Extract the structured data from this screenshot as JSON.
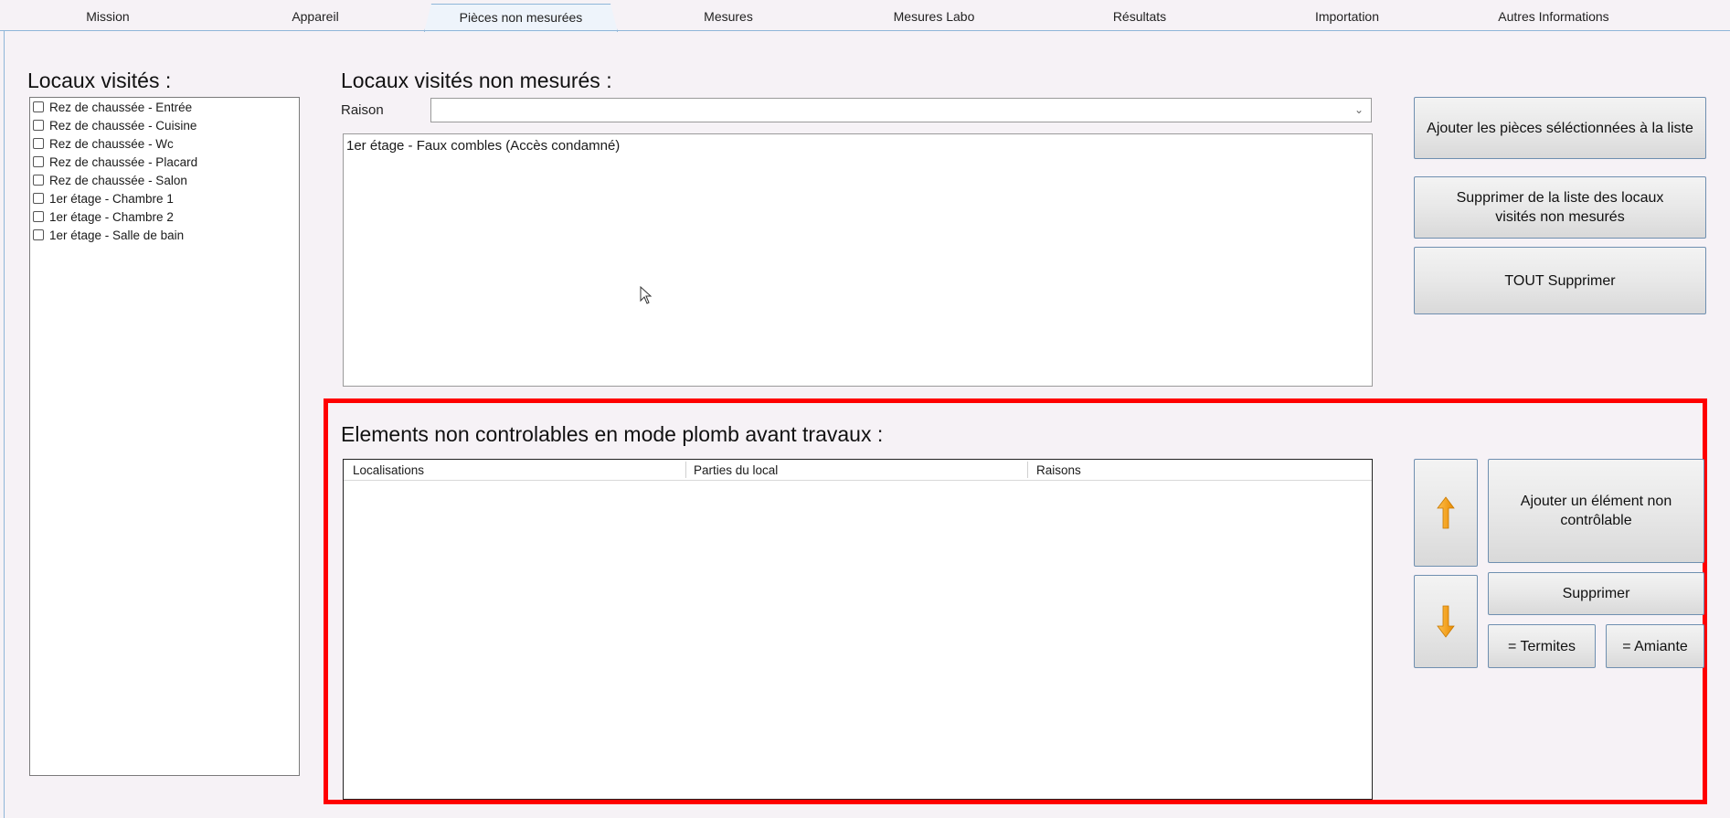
{
  "tabs": [
    {
      "label": "Mission",
      "active": false
    },
    {
      "label": "Appareil",
      "active": false
    },
    {
      "label": "Pièces non mesurées",
      "active": true
    },
    {
      "label": "Mesures",
      "active": false
    },
    {
      "label": "Mesures Labo",
      "active": false
    },
    {
      "label": "Résultats",
      "active": false
    },
    {
      "label": "Importation",
      "active": false
    },
    {
      "label": "Autres Informations",
      "active": false
    }
  ],
  "left": {
    "title": "Locaux visités :",
    "items": [
      "Rez de chaussée - Entrée",
      "Rez de chaussée - Cuisine",
      "Rez de chaussée - Wc",
      "Rez de chaussée - Placard",
      "Rez de chaussée - Salon",
      "1er étage - Chambre 1",
      "1er étage - Chambre 2",
      "1er étage - Salle de bain"
    ]
  },
  "unmeasured": {
    "title": "Locaux visités non mesurés :",
    "reason_label": "Raison",
    "reason_value": "",
    "list": [
      "1er étage - Faux combles (Accès condamné)"
    ]
  },
  "actions": {
    "add_selected": "Ajouter les pièces séléctionnées à la liste",
    "remove_from_list": "Supprimer de la liste des locaux visités non mesurés",
    "delete_all": "TOUT Supprimer"
  },
  "elements": {
    "title": "Elements non controlables en mode plomb avant travaux :",
    "columns": [
      "Localisations",
      "Parties du local",
      "Raisons"
    ],
    "rows": [],
    "add_button": "Ajouter un élément non contrôlable",
    "delete_button": "Supprimer",
    "termites_button": "= Termites",
    "amiante_button": "= Amiante"
  },
  "colors": {
    "highlight": "#ff0000",
    "arrow": "#f5a623",
    "tab_border": "#8fb6d9"
  }
}
